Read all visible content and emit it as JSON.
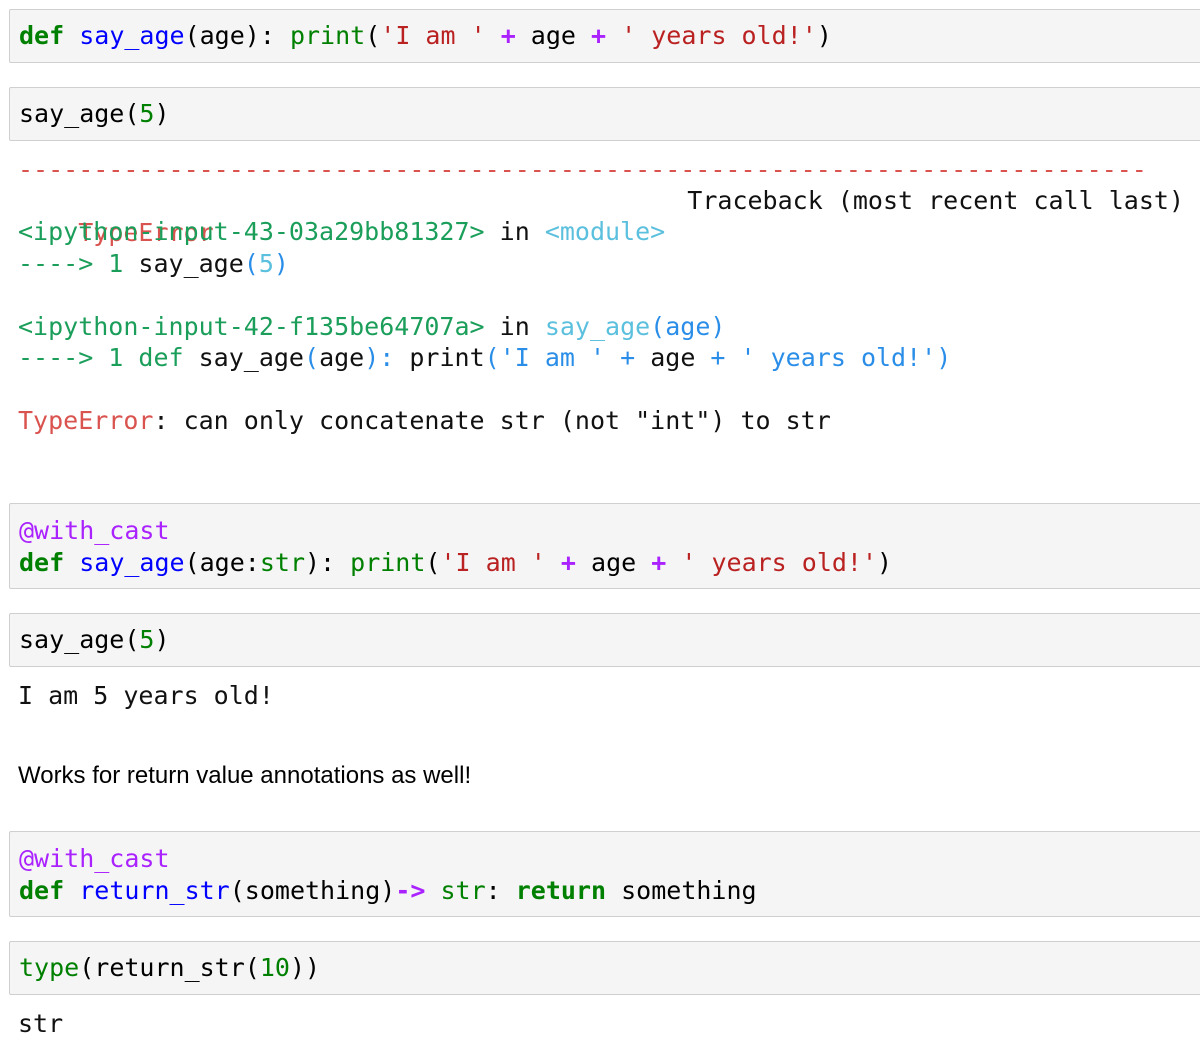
{
  "cell1": {
    "kw_def": "def",
    "fname": "say_age",
    "p1": "(age): ",
    "builtin_print": "print",
    "p2": "(",
    "str1": "'I am '",
    "op1": "+",
    "mid": " age ",
    "op2": "+",
    "str2": "' years old!'",
    "p3": ")"
  },
  "cell2": {
    "fname": "say_age",
    "p1": "(",
    "num": "5",
    "p2": ")"
  },
  "traceback": {
    "separator": "---------------------------------------------------------------------------",
    "err_name": "TypeError",
    "header_right": "Traceback (most recent call last)",
    "frame1_input": "<ipython-input-43-03a29bb81327>",
    "frame1_in": " in ",
    "frame1_module": "<module>",
    "frame1_arrow": "----> 1",
    "frame1_code": " say_age",
    "frame1_paren_open": "(",
    "frame1_num": "5",
    "frame1_paren_close": ")",
    "frame2_input": "<ipython-input-42-f135be64707a>",
    "frame2_in": " in ",
    "frame2_func": "say_age",
    "frame2_args": "(age)",
    "frame2_arrow": "----> 1",
    "frame2_def": " def",
    "frame2_fname": " say_age",
    "frame2_paren_open": "(",
    "frame2_arg": "age",
    "frame2_paren_close": "):",
    "frame2_print": " print",
    "frame2_p_open": "(",
    "frame2_str1": "'I am '",
    "frame2_plus1": " + ",
    "frame2_age": "age",
    "frame2_plus2": " + ",
    "frame2_str2": "' years old!'",
    "frame2_p_close": ")",
    "final_err": "TypeError",
    "final_msg": ": can only concatenate str (not \"int\") to str"
  },
  "cell3": {
    "decorator": "@with_cast",
    "kw_def": "def",
    "fname": "say_age",
    "p1": "(age:",
    "builtin_str": "str",
    "p2": "): ",
    "builtin_print": "print",
    "p3": "(",
    "str1": "'I am '",
    "op1": "+",
    "mid": " age ",
    "op2": "+",
    "str2": "' years old!'",
    "p4": ")"
  },
  "cell4": {
    "fname": "say_age",
    "p1": "(",
    "num": "5",
    "p2": ")"
  },
  "output4": "I am 5 years old!",
  "markdown": "Works for return value annotations as well!",
  "cell5": {
    "decorator": "@with_cast",
    "kw_def": "def",
    "fname": "return_str",
    "p1": "(something)",
    "arrow": "->",
    "builtin_str": " str",
    "p2": ": ",
    "kw_return": "return",
    "p3": " something"
  },
  "cell6": {
    "builtin_type": "type",
    "p1": "(return_str(",
    "num": "10",
    "p2": "))"
  },
  "output6": "str"
}
